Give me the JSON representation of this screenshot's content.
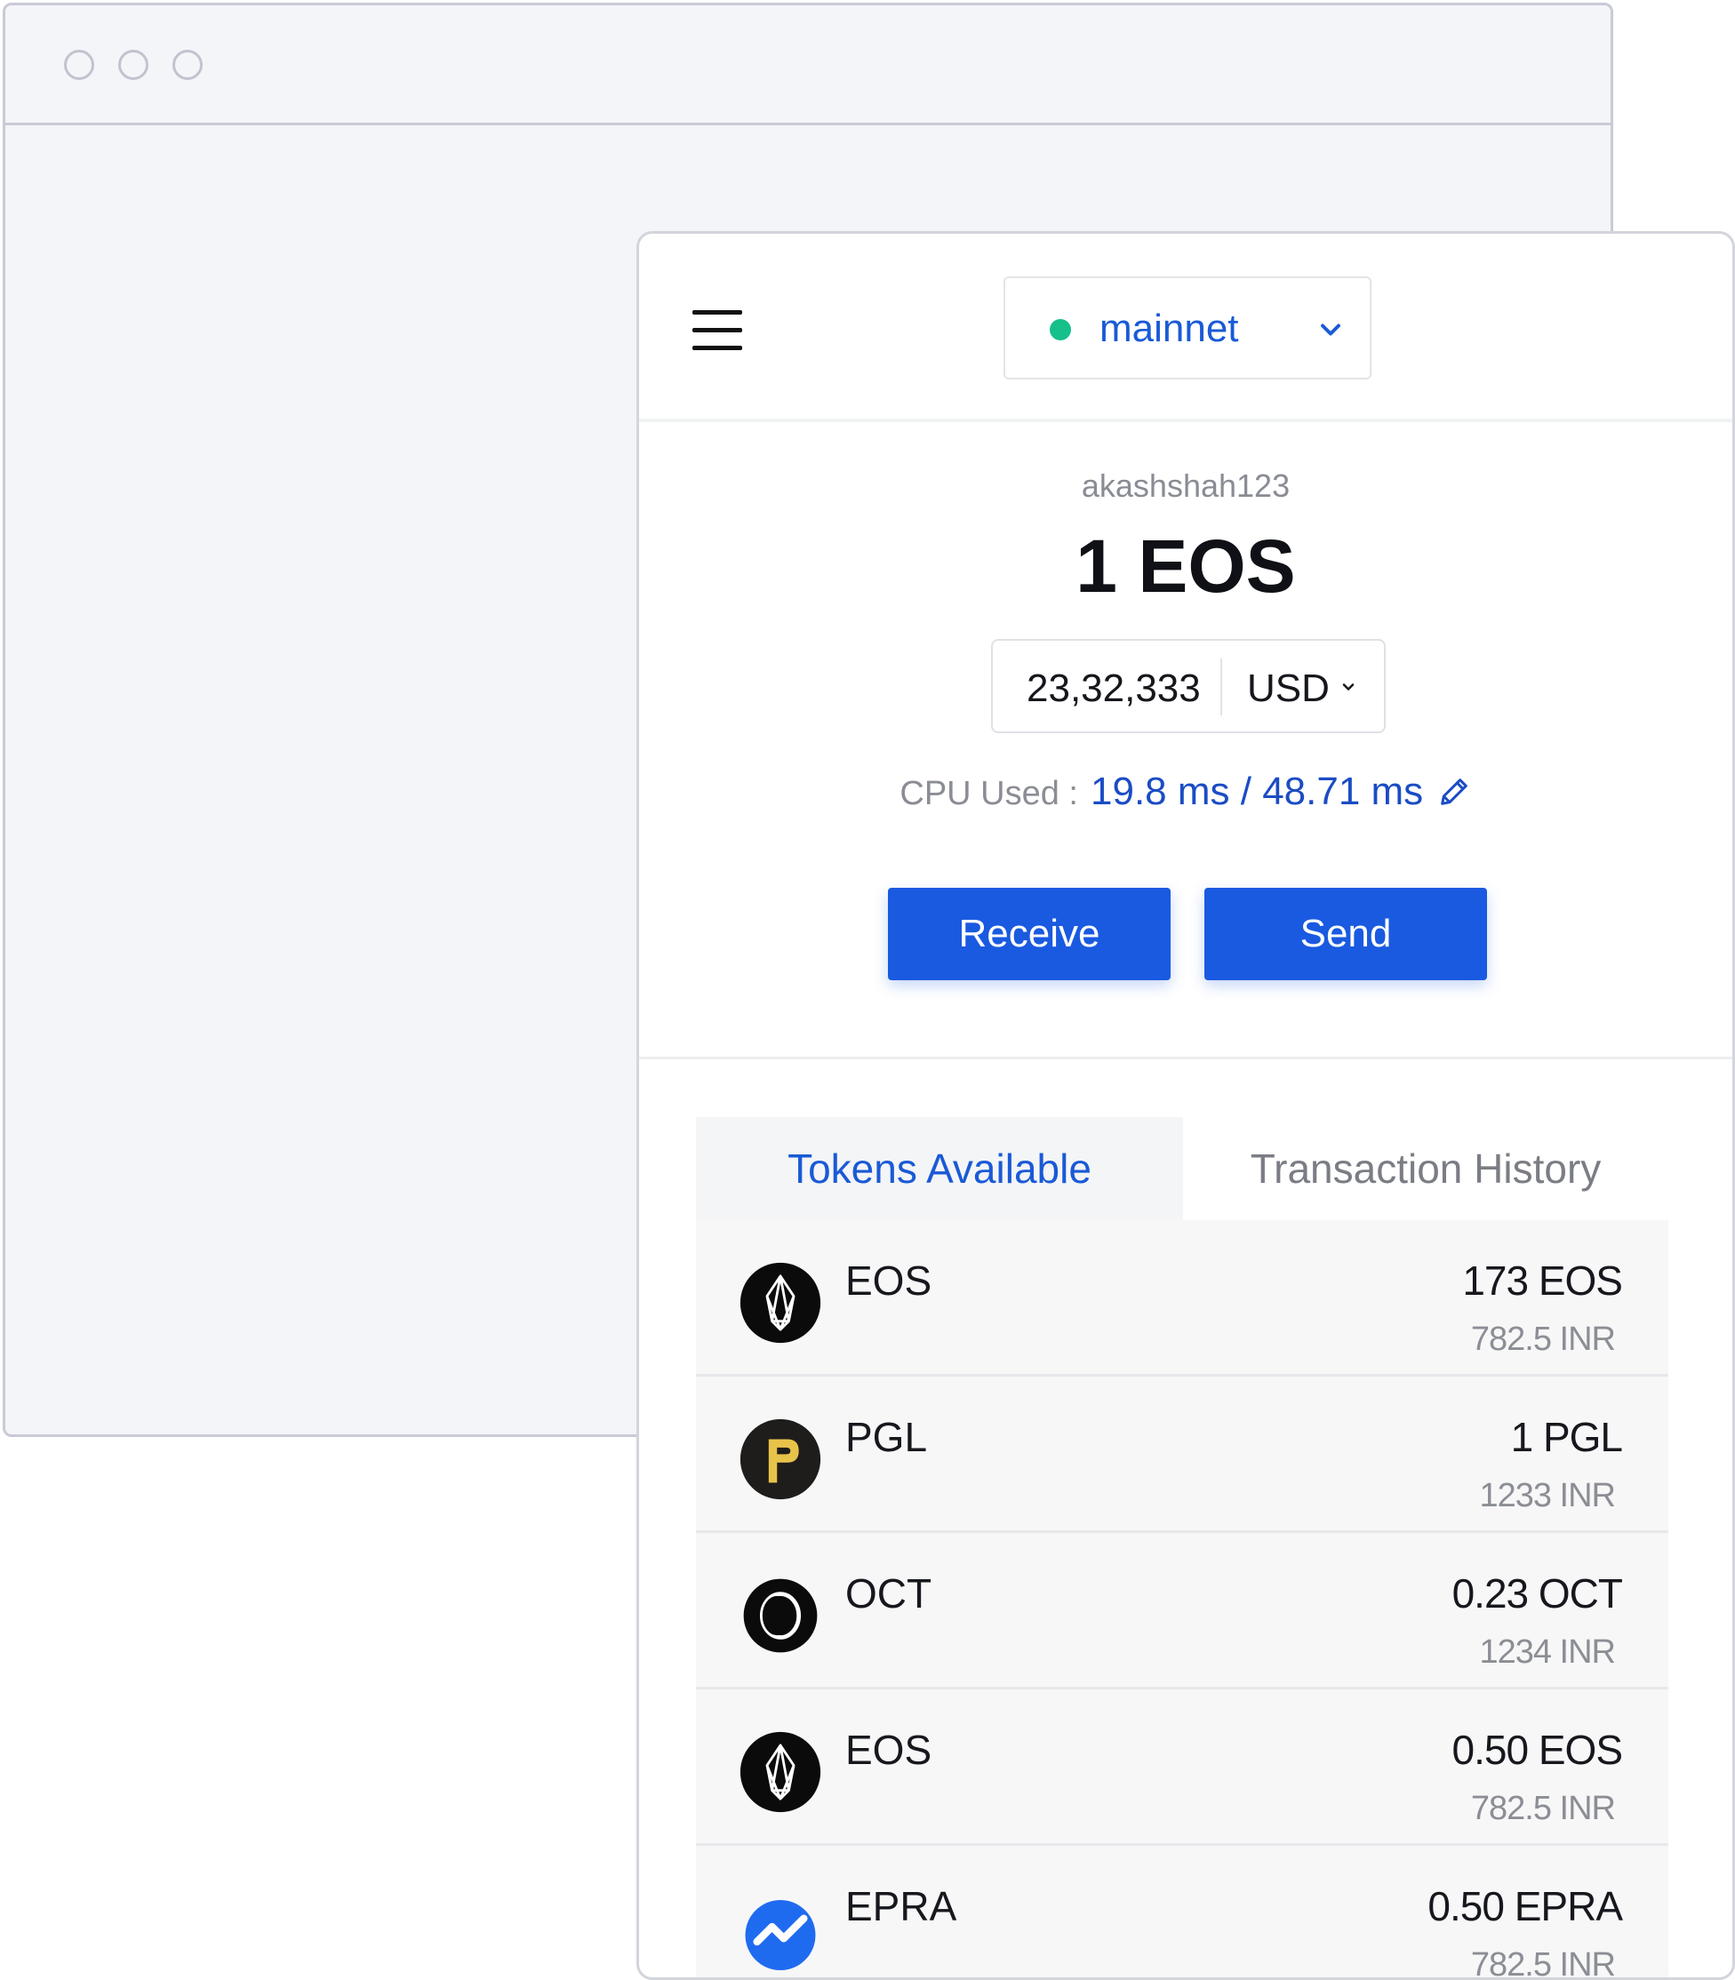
{
  "network": {
    "label": "mainnet",
    "status_color": "#16c08a"
  },
  "account": {
    "name": "akashshah123",
    "balance": "1 EOS"
  },
  "fiat": {
    "value": "23,32,333",
    "currency": "USD"
  },
  "cpu": {
    "label": "CPU Used :",
    "value": "19.8 ms / 48.71 ms"
  },
  "actions": {
    "receive": "Receive",
    "send": "Send"
  },
  "tabs": {
    "active": "Tokens Available",
    "inactive": "Transaction History"
  },
  "tokens": [
    {
      "name": "EOS",
      "amount": "173 EOS",
      "fiat": "782.5 INR",
      "icon": "eos-icon"
    },
    {
      "name": "PGL",
      "amount": "1 PGL",
      "fiat": "1233 INR",
      "icon": "pgl-icon"
    },
    {
      "name": "OCT",
      "amount": "0.23 OCT",
      "fiat": "1234 INR",
      "icon": "oct-icon"
    },
    {
      "name": "EOS",
      "amount": "0.50 EOS",
      "fiat": "782.5 INR",
      "icon": "eos-icon"
    },
    {
      "name": "EPRA",
      "amount": "0.50 EPRA",
      "fiat": "782.5 INR",
      "icon": "epra-icon"
    }
  ],
  "colors": {
    "accent": "#1a5ae0",
    "link": "#1a4cc4",
    "online": "#16c08a"
  }
}
